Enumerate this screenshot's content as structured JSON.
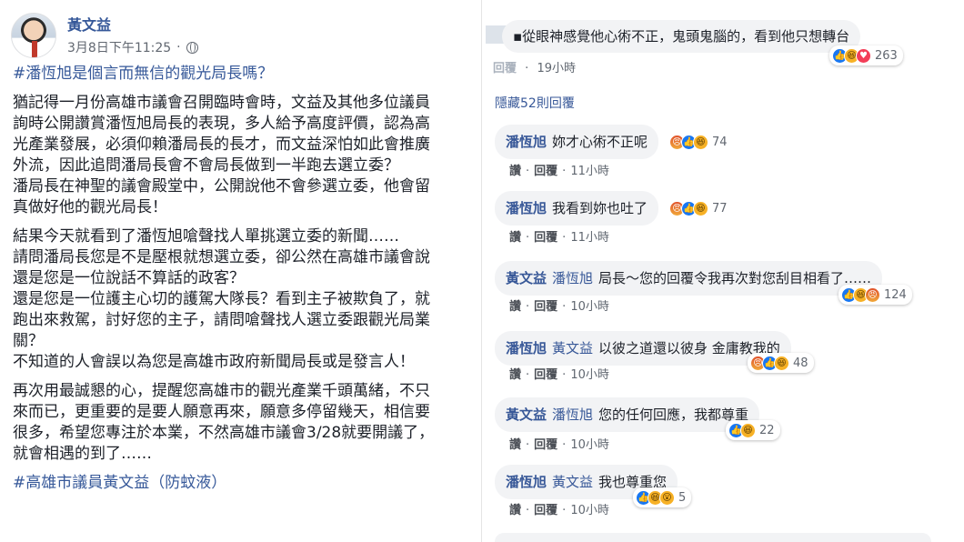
{
  "post": {
    "author": "黃文益",
    "timestamp": "3月8日下午11:25",
    "privacy_sep": "·",
    "title_hashtag": "#潘恆旭是個言而無信的觀光局長嗎？",
    "paragraphs": [
      [
        "猶記得一月份高雄市議會召開臨時會時，文益及其他多位議員",
        "詢時公開讚賞潘恆旭局長的表現，多人給予高度評價，認為高",
        "光產業發展，必須仰賴潘局長的長才，而文益深怕如此會推廣",
        "外流，因此追問潘局長會不會局長做到一半跑去選立委？",
        "潘局長在神聖的議會殿堂中，公開說他不會參選立委，他會留",
        "真做好他的觀光局長！"
      ],
      [
        "結果今天就看到了潘恆旭嗆聲找人單挑選立委的新聞……",
        "請問潘局長您是不是壓根就想選立委，卻公然在高雄市議會說",
        "還是您是一位說話不算話的政客？",
        "還是您是一位護主心切的護駕大隊長？看到主子被欺負了，就",
        "跑出來救駕，討好您的主子，請問嗆聲找人選立委跟觀光局業",
        "關？",
        "不知道的人會誤以為您是高雄市政府新聞局長或是發言人！"
      ],
      [
        "再次用最誠懇的心，提醒您高雄市的觀光產業千頭萬緒，不只",
        "來而已，更重要的是要人願意再來，願意多停留幾天，相信要",
        "很多，希望您專注於本業，不然高雄市議會3/28就要開議了，",
        "就會相遇的到了……"
      ]
    ],
    "footer_hashtag": "#高雄市議員黃文益（防蚊液）"
  },
  "comments": {
    "top": {
      "text": "▪從眼神感覺他心術不正，鬼頭鬼腦的，看到他只想轉台",
      "reaction_count": "263",
      "action_fragment": "回覆",
      "time": "19小時"
    },
    "hidden_replies": "隱藏52則回覆",
    "action_like": "讚",
    "action_reply": "回覆",
    "action_sep": "·",
    "replies": [
      {
        "name": "潘恆旭",
        "tag": "",
        "text": "妳才心術不正呢",
        "count": "74",
        "time": "11小時",
        "reacts": [
          "angry",
          "like",
          "haha"
        ]
      },
      {
        "name": "潘恆旭",
        "tag": "",
        "text": "我看到妳也吐了",
        "count": "77",
        "time": "11小時",
        "reacts": [
          "angry",
          "like",
          "haha"
        ]
      },
      {
        "name": "黃文益",
        "tag": "潘恆旭",
        "text": "局長～您的回覆令我再次對您刮目相看了……",
        "count": "124",
        "time": "10小時",
        "reacts": [
          "like",
          "haha",
          "angry"
        ]
      },
      {
        "name": "潘恆旭",
        "tag": "黃文益",
        "text": "以彼之道還以彼身 金庸教我的",
        "count": "48",
        "time": "10小時",
        "reacts": [
          "angry",
          "like",
          "haha"
        ]
      },
      {
        "name": "黃文益",
        "tag": "潘恆旭",
        "text": "您的任何回應，我都尊重",
        "count": "22",
        "time": "10小時",
        "reacts": [
          "like",
          "haha"
        ]
      },
      {
        "name": "潘恆旭",
        "tag": "黃文益",
        "text": "我也尊重您",
        "count": "5",
        "time": "10小時",
        "reacts": [
          "like",
          "haha",
          "wow"
        ]
      }
    ]
  },
  "colors": {
    "link": "#365899",
    "bubble": "#f2f3f5",
    "like": "#1877f2",
    "haha": "#f7b125",
    "angry": "#e0512a"
  }
}
